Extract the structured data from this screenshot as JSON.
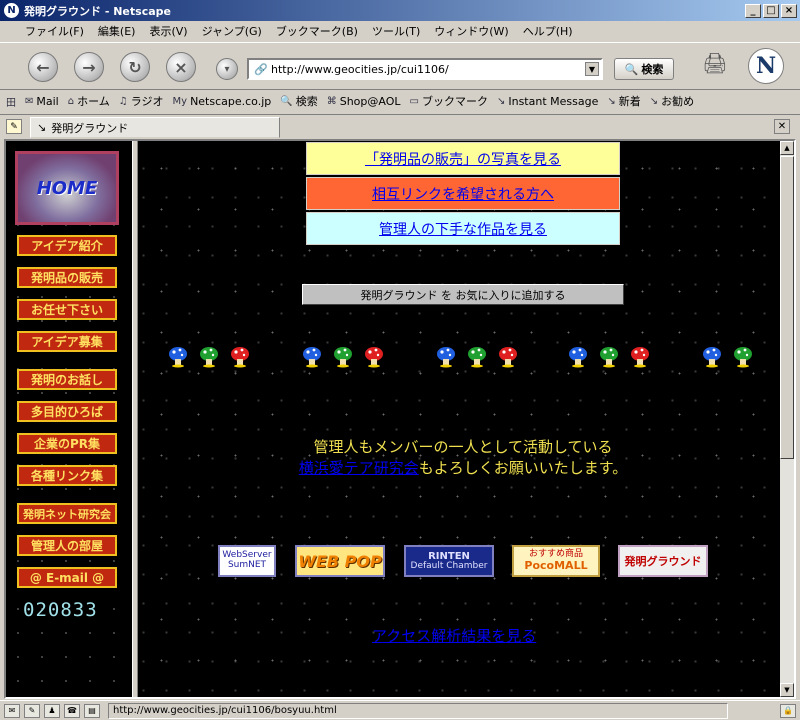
{
  "window": {
    "title": "発明グラウンド - Netscape"
  },
  "menu": [
    "ファイル(F)",
    "編集(E)",
    "表示(V)",
    "ジャンプ(G)",
    "ブックマーク(B)",
    "ツール(T)",
    "ウィンドウ(W)",
    "ヘルプ(H)"
  ],
  "nav": {
    "url": "http://www.geocities.jp/cui1106/",
    "search_label": "検索"
  },
  "personal_toolbar": [
    "Mail",
    "ホーム",
    "ラジオ",
    "Netscape.co.jp",
    "検索",
    "Shop@AOL",
    "ブックマーク",
    "Instant Message",
    "新着",
    "お勧め"
  ],
  "tab": {
    "title": "発明グラウンド"
  },
  "sidebar": {
    "home_label": "HOME",
    "buttons": [
      "アイデア紹介",
      "発明品の販売",
      "お任せ下さい",
      "アイデア募集",
      "発明のお話し",
      "多目的ひろば",
      "企業のPR集",
      "各種リンク集",
      "発明ネット研究会",
      "管理人の部屋",
      "@ E-mail @"
    ],
    "counter": "020833"
  },
  "main": {
    "top_buttons": [
      {
        "label": "「発明品の販売」の写真を見る",
        "color": "#ffff99"
      },
      {
        "label": "相互リンクを希望される方へ",
        "color": "#ff6633"
      },
      {
        "label": "管理人の下手な作品を見る",
        "color": "#ccffff"
      }
    ],
    "favorite_button": "発明グラウンド を お気に入りに追加する",
    "message_line1": "管理人もメンバーの一人として活動している",
    "message_link": "横浜愛テア研究会",
    "message_line2": "もよろしくお願いいたします。",
    "banners": [
      "WebServer",
      "SumNET",
      "WEB POP",
      "RINTEN",
      "Default Chamber",
      "おすすめ商品",
      "PocoMALL",
      "発明グラウンド"
    ],
    "access_link": "アクセス解析結果を見る"
  },
  "status": {
    "text": "http://www.geocities.jp/cui1106/bosyuu.html"
  }
}
